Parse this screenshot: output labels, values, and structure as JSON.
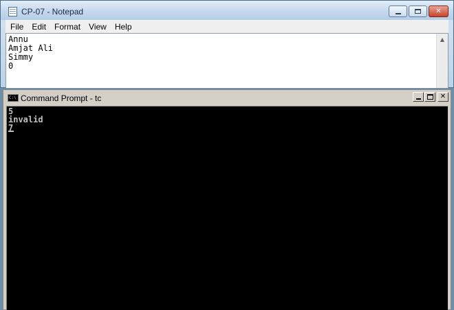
{
  "notepad": {
    "title": "CP-07 - Notepad",
    "menu": [
      "File",
      "Edit",
      "Format",
      "View",
      "Help"
    ],
    "content_lines": [
      "Annu",
      "Amjat Ali",
      "Simmy",
      "0"
    ]
  },
  "cmd": {
    "title": "Command Prompt - tc",
    "output_lines": [
      "5",
      "invalid",
      "7"
    ]
  }
}
